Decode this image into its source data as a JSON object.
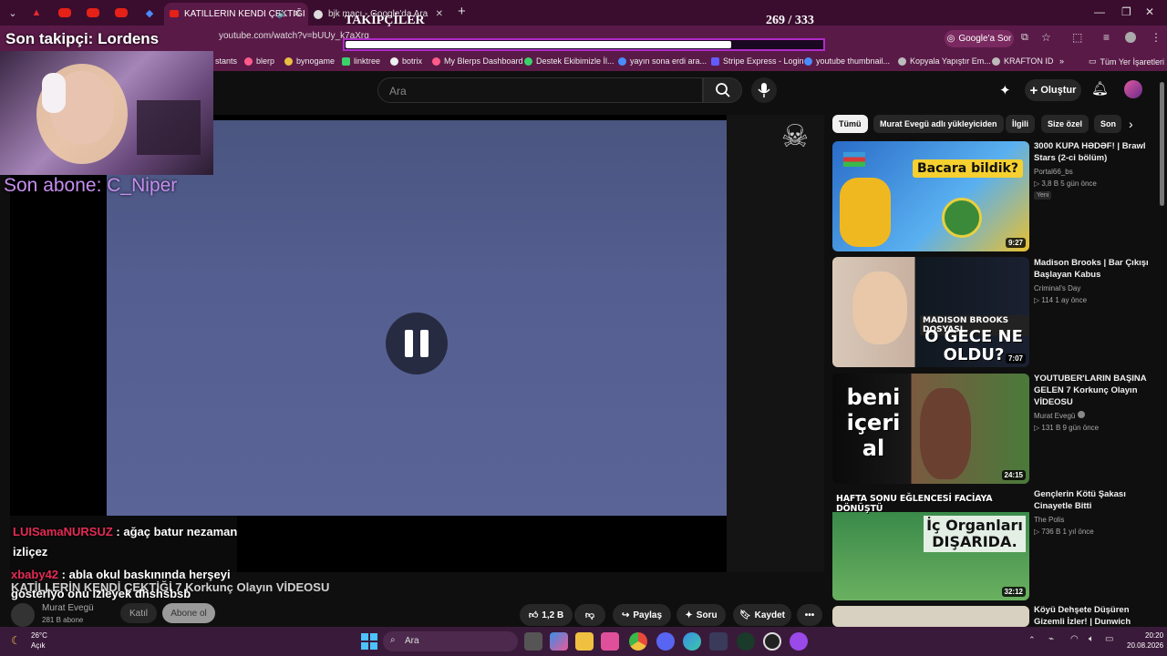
{
  "browser": {
    "active_tab": "KATILLERIN KENDI ÇEKTIĞI",
    "tab2": "bjk maçı - Google'da Ara",
    "url": "youtube.com/watch?v=bUUy_k7aXrg",
    "google_sor": "Google'a Sor",
    "bookmarks": [
      "stants",
      "blerp",
      "bynogame",
      "linktree",
      "botrix",
      "My Blerps Dashboard",
      "Destek Ekibimizle İl...",
      "yayın sona erdi ara...",
      "Stripe Express - Login",
      "youtube thumbnail...",
      "Kopyala Yapıştır Em...",
      "KRAFTON ID",
      "»",
      "Tüm Yer İşaretleri"
    ]
  },
  "overlay": {
    "son_takipci": "Son takipçi: Lordens",
    "son_abone": "Son abone: C_Niper",
    "takipciler": "TAKİPÇİLER",
    "count": "269 / 333",
    "progress": 0.808
  },
  "chat": [
    {
      "user": "LUISamaNURSUZ",
      "msg": " : ağaç batur nezaman izliçez"
    },
    {
      "user": "xbaby42",
      "msg": " : abla okul baskınında herşeyi gosteriyo onu izleyek dhshsbsb"
    }
  ],
  "youtube": {
    "search_placeholder": "Ara",
    "create": "Oluştur",
    "video_title": "KATİLLERİN KENDİ ÇEKTİĞİ 7 Korkunç Olayın VİDEOSU",
    "channel": "Murat Evegü",
    "subs": "281 B abone",
    "join": "Katıl",
    "subscribe": "Abone ol",
    "likes": "1,2 B",
    "share": "Paylaş",
    "ask": "Soru",
    "save": "Kaydet",
    "chips": [
      "Tümü",
      "Murat Evegü adlı yükleyiciden",
      "İlgili",
      "Size özel",
      "Son"
    ],
    "recs": [
      {
        "title": "3000 KUPA HƏDƏF! | Brawl Stars (2-ci bölüm)",
        "channel": "Portal66_bs",
        "meta": "▷ 3,8 B   5 gün önce",
        "badge": "Yeni",
        "duration": "9:27",
        "thumb_text": "Bacara bildik?"
      },
      {
        "title": "Madison Brooks | Bar Çıkışı Başlayan Kabus",
        "channel": "Criminal's Day",
        "meta": "▷ 114   1 ay önce",
        "duration": "7:07",
        "thumb_text": "MADISON BROOKS DOSYASI",
        "thumb_text2": "O GECE NE OLDU?"
      },
      {
        "title": "YOUTUBER'LARIN BAŞINA GELEN 7 Korkunç Olayın VİDEOSU",
        "channel": "Murat Evegü",
        "meta": "▷ 131 B   9 gün önce",
        "duration": "24:15",
        "thumb_text": "beni içeri al"
      },
      {
        "title": "Gençlerin Kötü Şakası Cinayetle Bitti",
        "channel": "The Polis",
        "meta": "▷ 736 B   1 yıl önce",
        "duration": "32:12",
        "thumb_text": "HAFTA SONU EĞLENCESİ FACİAYA DÖNÜŞTÜ",
        "thumb_text2": "İç Organları DIŞARIDA."
      },
      {
        "title": "Köyü Dehşete Düşüren Gizemli İzler! | Dunwich"
      }
    ]
  },
  "taskbar": {
    "temp": "26°C",
    "cond": "Açık",
    "search": "Ara",
    "time": "20:20",
    "date": "20.08.2026"
  },
  "colors": {
    "accent": "#b02ac8",
    "chat_user": "#e52a55",
    "abone": "#c58ef0"
  }
}
